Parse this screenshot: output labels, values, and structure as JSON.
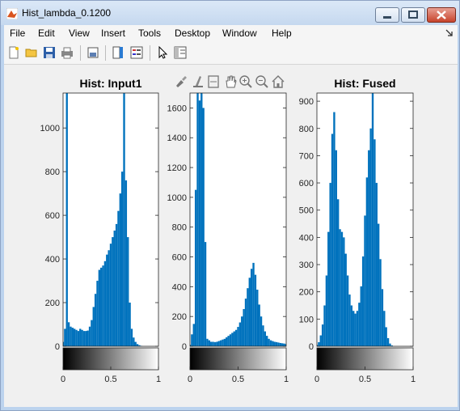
{
  "window": {
    "title": "Hist_lambda_0.1200"
  },
  "menu": [
    "File",
    "Edit",
    "View",
    "Insert",
    "Tools",
    "Desktop",
    "Window",
    "Help"
  ],
  "toolbar_icons": [
    "new-file-icon",
    "open-folder-icon",
    "save-icon",
    "print-icon",
    "print-preview-icon",
    "colorbar-icon",
    "legend-icon",
    "pointer-icon",
    "property-inspector-icon"
  ],
  "axes_toolbar_icons": [
    "brush-icon",
    "data-cursor-icon",
    "link-icon",
    "pan-icon",
    "zoom-in-icon",
    "zoom-out-icon",
    "home-icon"
  ],
  "colors": {
    "bar": "#0072BD",
    "titlebar": "#c5d8ef",
    "close": "#c7442c"
  },
  "chart_data": [
    {
      "type": "bar",
      "title": "Hist: Input1",
      "xlim": [
        0,
        1
      ],
      "ylim": [
        0,
        1160
      ],
      "xticks": [
        0,
        0.5,
        1
      ],
      "yticks": [
        0,
        200,
        400,
        600,
        800,
        1000
      ],
      "x": [
        0.0,
        0.02,
        0.04,
        0.06,
        0.08,
        0.1,
        0.12,
        0.14,
        0.16,
        0.18,
        0.2,
        0.22,
        0.24,
        0.26,
        0.28,
        0.3,
        0.32,
        0.34,
        0.36,
        0.38,
        0.4,
        0.42,
        0.44,
        0.46,
        0.48,
        0.5,
        0.52,
        0.54,
        0.56,
        0.58,
        0.6,
        0.62,
        0.64,
        0.66,
        0.68,
        0.7,
        0.72,
        0.74,
        0.76,
        0.78,
        0.8,
        0.82,
        0.84,
        0.86,
        0.88,
        0.9,
        0.92,
        0.94,
        0.96,
        0.98,
        1.0
      ],
      "values": [
        20,
        80,
        1160,
        110,
        90,
        85,
        80,
        75,
        70,
        80,
        75,
        70,
        70,
        72,
        90,
        120,
        180,
        240,
        300,
        350,
        360,
        370,
        390,
        420,
        440,
        470,
        500,
        530,
        560,
        620,
        700,
        800,
        1160,
        760,
        500,
        200,
        80,
        40,
        20,
        10,
        5,
        2,
        0,
        0,
        0,
        0,
        0,
        0,
        0,
        0,
        0
      ]
    },
    {
      "type": "bar",
      "title": "",
      "xlim": [
        0,
        1
      ],
      "ylim": [
        0,
        1700
      ],
      "xticks": [
        0,
        0.5,
        1
      ],
      "yticks": [
        0,
        200,
        400,
        600,
        800,
        1000,
        1200,
        1400,
        1600
      ],
      "x": [
        0.0,
        0.02,
        0.04,
        0.06,
        0.08,
        0.1,
        0.12,
        0.14,
        0.16,
        0.18,
        0.2,
        0.22,
        0.24,
        0.26,
        0.28,
        0.3,
        0.32,
        0.34,
        0.36,
        0.38,
        0.4,
        0.42,
        0.44,
        0.46,
        0.48,
        0.5,
        0.52,
        0.54,
        0.56,
        0.58,
        0.6,
        0.62,
        0.64,
        0.66,
        0.68,
        0.7,
        0.72,
        0.74,
        0.76,
        0.78,
        0.8,
        0.82,
        0.84,
        0.86,
        0.88,
        0.9,
        0.92,
        0.94,
        0.96,
        0.98,
        1.0
      ],
      "values": [
        10,
        80,
        150,
        1050,
        1700,
        1650,
        1700,
        1600,
        700,
        50,
        40,
        30,
        30,
        28,
        30,
        35,
        40,
        45,
        50,
        60,
        70,
        80,
        90,
        100,
        110,
        130,
        160,
        200,
        250,
        320,
        390,
        460,
        520,
        560,
        480,
        380,
        280,
        200,
        140,
        100,
        70,
        50,
        40,
        35,
        30,
        28,
        25,
        22,
        20,
        18,
        15
      ]
    },
    {
      "type": "bar",
      "title": "Hist: Fused",
      "xlim": [
        0,
        1
      ],
      "ylim": [
        0,
        930
      ],
      "xticks": [
        0,
        0.5,
        1
      ],
      "yticks": [
        0,
        100,
        200,
        300,
        400,
        500,
        600,
        700,
        800,
        900
      ],
      "x": [
        0.0,
        0.02,
        0.04,
        0.06,
        0.08,
        0.1,
        0.12,
        0.14,
        0.16,
        0.18,
        0.2,
        0.22,
        0.24,
        0.26,
        0.28,
        0.3,
        0.32,
        0.34,
        0.36,
        0.38,
        0.4,
        0.42,
        0.44,
        0.46,
        0.48,
        0.5,
        0.52,
        0.54,
        0.56,
        0.58,
        0.6,
        0.62,
        0.64,
        0.66,
        0.68,
        0.7,
        0.72,
        0.74,
        0.76,
        0.78,
        0.8,
        0.82,
        0.84,
        0.86,
        0.88,
        0.9,
        0.92,
        0.94,
        0.96,
        0.98,
        1.0
      ],
      "values": [
        5,
        15,
        40,
        80,
        150,
        260,
        420,
        600,
        780,
        860,
        720,
        540,
        430,
        420,
        400,
        340,
        260,
        190,
        150,
        130,
        120,
        130,
        160,
        220,
        330,
        480,
        620,
        720,
        800,
        930,
        760,
        600,
        450,
        320,
        210,
        130,
        70,
        30,
        10,
        3,
        0,
        0,
        0,
        0,
        0,
        0,
        0,
        0,
        0,
        0,
        0
      ]
    }
  ]
}
